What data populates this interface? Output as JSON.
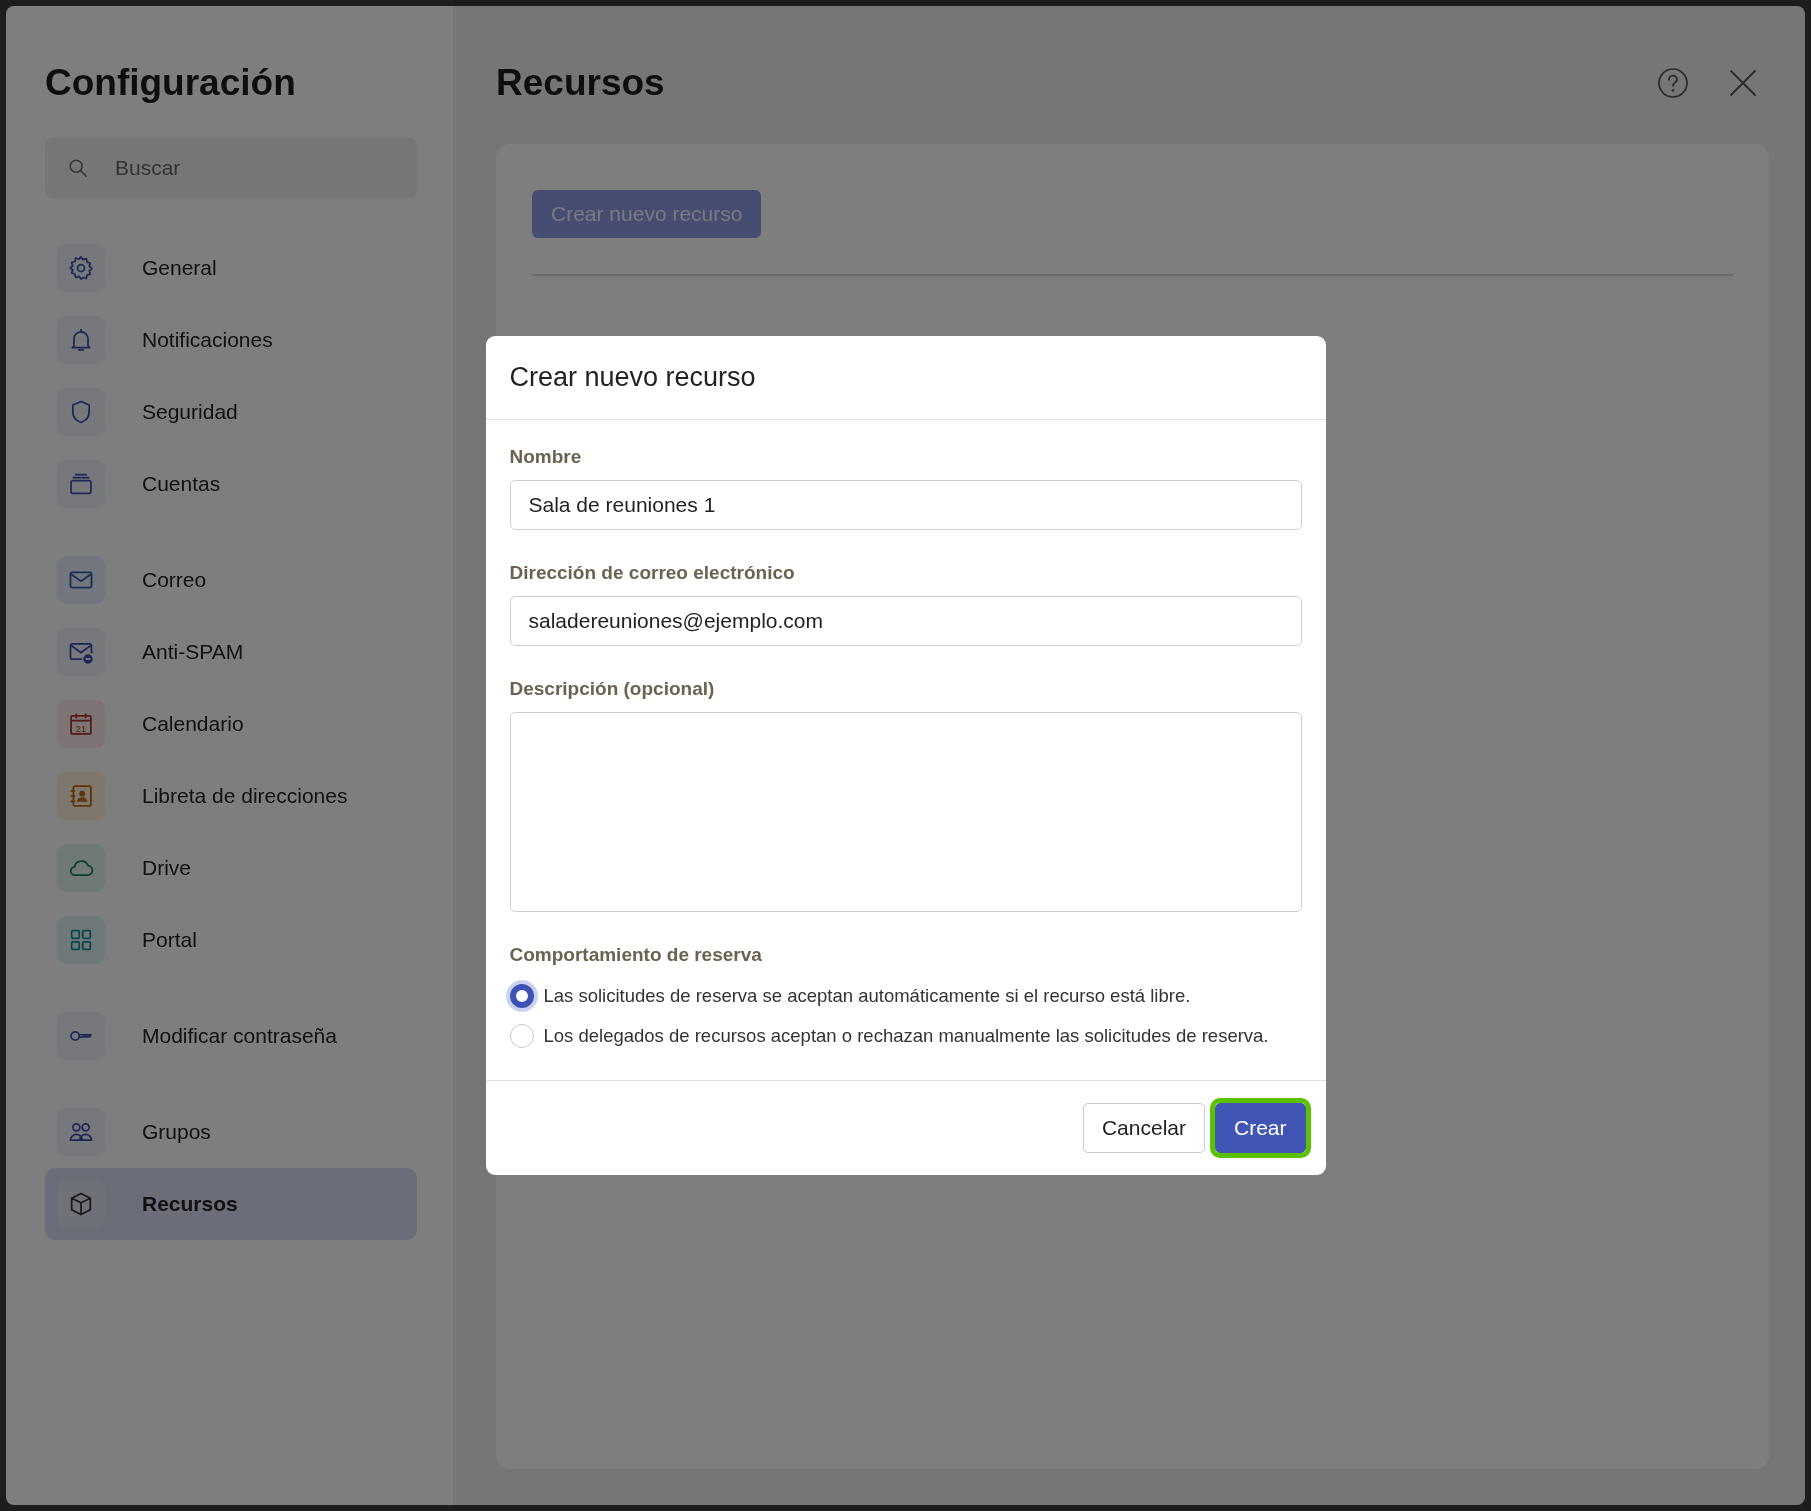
{
  "sidebar": {
    "title": "Configuración",
    "search": {
      "placeholder": "Buscar"
    },
    "groups": [
      [
        {
          "label": "General",
          "selected": false
        },
        {
          "label": "Notificaciones",
          "selected": false
        },
        {
          "label": "Seguridad",
          "selected": false
        },
        {
          "label": "Cuentas",
          "selected": false
        }
      ],
      [
        {
          "label": "Correo",
          "selected": false
        },
        {
          "label": "Anti-SPAM",
          "selected": false
        },
        {
          "label": "Calendario",
          "selected": false,
          "icon_text": "21"
        },
        {
          "label": "Libreta de direcciones",
          "selected": false
        },
        {
          "label": "Drive",
          "selected": false
        },
        {
          "label": "Portal",
          "selected": false
        }
      ],
      [
        {
          "label": "Modificar contraseña",
          "selected": false
        }
      ],
      [
        {
          "label": "Grupos",
          "selected": false
        },
        {
          "label": "Recursos",
          "selected": true
        }
      ]
    ]
  },
  "main": {
    "title": "Recursos",
    "create_button": "Crear nuevo recurso"
  },
  "dialog": {
    "title": "Crear nuevo recurso",
    "fields": [
      {
        "kind": "input",
        "label": "Nombre",
        "value": "Sala de reuniones 1"
      },
      {
        "kind": "input",
        "label": "Dirección de correo electrónico",
        "value": "saladereuniones@ejemplo.com"
      },
      {
        "kind": "textarea",
        "label": "Descripción (opcional)"
      }
    ],
    "booking": {
      "label": "Comportamiento de reserva",
      "options": [
        {
          "label": "Las solicitudes de reserva se aceptan automáticamente si el recurso está libre.",
          "selected": true
        },
        {
          "label": "Los delegados de recursos aceptan o rechazan manualmente las solicitudes de reserva.",
          "selected": false
        }
      ]
    },
    "buttons": [
      {
        "label": "Cancelar",
        "kind": "secondary",
        "focused": false
      },
      {
        "label": "Crear",
        "kind": "primary",
        "focused": true
      }
    ]
  }
}
